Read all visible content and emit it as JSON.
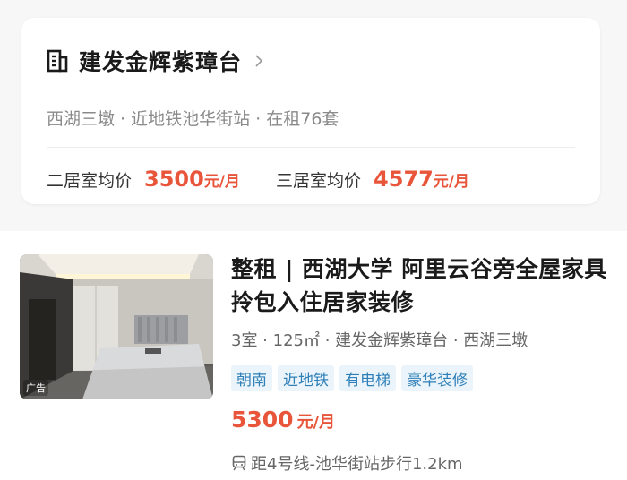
{
  "community": {
    "name": "建发金辉紫璋台",
    "subtitle": "西湖三墩 · 近地铁池华街站 · 在租76套",
    "prices": [
      {
        "label": "二居室均价",
        "value": "3500",
        "unit": "元/月"
      },
      {
        "label": "三居室均价",
        "value": "4577",
        "unit": "元/月"
      }
    ],
    "icons": {
      "building": "building-icon",
      "chevron": "chevron-right-icon"
    }
  },
  "listing": {
    "title": "整租 | 西湖大学 阿里云谷旁全屋家具拎包入住居家装修",
    "meta": "3室 · 125㎡ · 建发金辉紫璋台 · 西湖三墩",
    "tags": [
      "朝南",
      "近地铁",
      "有电梯",
      "豪华装修"
    ],
    "price": "5300",
    "price_unit": "元/月",
    "subway": "距4号线-池华街站步行1.2km",
    "ad_label": "广告",
    "icons": {
      "subway": "subway-icon"
    }
  },
  "colors": {
    "accent": "#e8553a",
    "tag_text": "#2f7fb8",
    "tag_bg": "#eaf4fa"
  }
}
